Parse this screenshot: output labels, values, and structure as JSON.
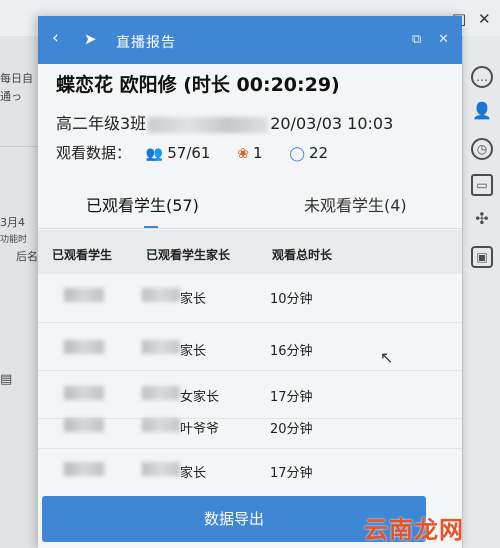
{
  "background_app": {
    "left_texts": [
      "每日自",
      "通っ",
      "3月4",
      "功能时",
      "后名"
    ],
    "window_controls": [
      "—",
      "□",
      "✕"
    ]
  },
  "dialog": {
    "title": "直播报告",
    "live_title": "蝶恋花 欧阳修 (时长 00:20:29)",
    "class_prefix": "高二年级3班",
    "class_suffix": "20/03/03 10:03",
    "stats_label": "观看数据：",
    "viewers": "57/61",
    "likes": "1",
    "comments": "22",
    "tabs": [
      {
        "label": "已观看学生(57)",
        "active": true
      },
      {
        "label": "未观看学生(4)",
        "active": false
      }
    ],
    "table": {
      "headers": [
        "已观看学生",
        "已观看学生家长",
        "观看总时长"
      ],
      "rows": [
        {
          "parent_suffix": "家长",
          "duration": "10分钟"
        },
        {
          "parent_suffix": "家长",
          "duration": "16分钟"
        },
        {
          "parent_suffix": "女家长",
          "duration": "17分钟"
        },
        {
          "parent_suffix": "叶爷爷",
          "duration": "20分钟"
        },
        {
          "parent_suffix": "家长",
          "duration": "17分钟"
        }
      ]
    },
    "export_button": "数据导出"
  },
  "watermark": "云南龙网",
  "colors": {
    "accent": "#3f86d4",
    "like_icon": "#d9622b",
    "comment_icon": "#3f86d4"
  },
  "icons": {
    "viewers": "people-icon",
    "likes": "flower-icon",
    "comments": "chat-bubble-icon"
  }
}
